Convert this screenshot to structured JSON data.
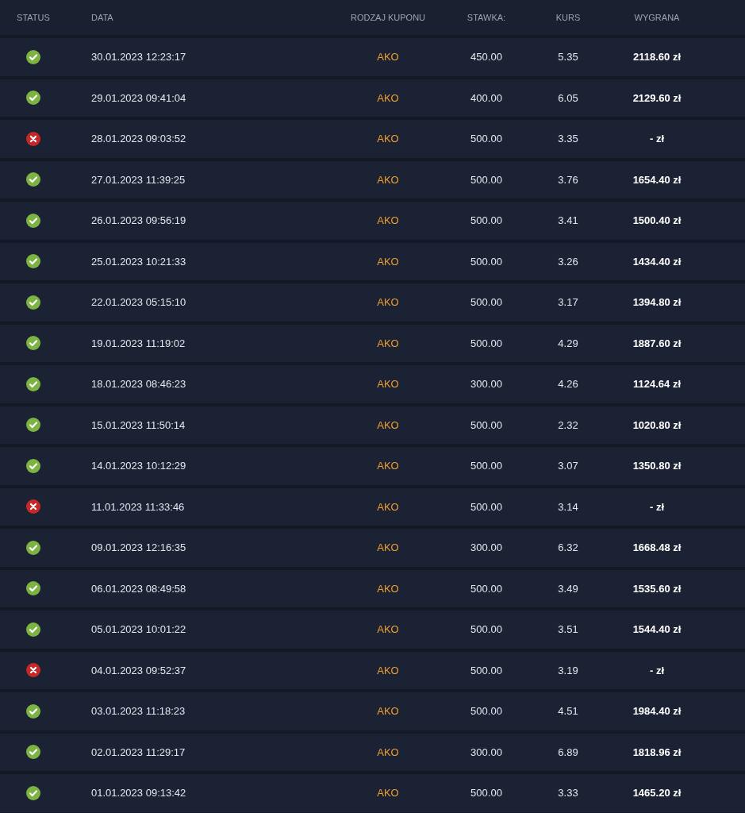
{
  "columns": [
    "STATUS",
    "DATA",
    "RODZAJ KUPONU",
    "STAWKA:",
    "KURS",
    "WYGRANA"
  ],
  "rows": [
    {
      "kind": "won",
      "date": "30.01.2023 12:23:17",
      "type": "AKO",
      "stake": "450.00",
      "odds": "5.35",
      "payout": "2118.60 zł"
    },
    {
      "kind": "won",
      "date": "29.01.2023 09:41:04",
      "type": "AKO",
      "stake": "400.00",
      "odds": "6.05",
      "payout": "2129.60 zł"
    },
    {
      "kind": "lost",
      "date": "28.01.2023 09:03:52",
      "type": "AKO",
      "stake": "500.00",
      "odds": "3.35",
      "payout": "- zł"
    },
    {
      "kind": "won",
      "date": "27.01.2023 11:39:25",
      "type": "AKO",
      "stake": "500.00",
      "odds": "3.76",
      "payout": "1654.40 zł"
    },
    {
      "kind": "won",
      "date": "26.01.2023 09:56:19",
      "type": "AKO",
      "stake": "500.00",
      "odds": "3.41",
      "payout": "1500.40 zł"
    },
    {
      "kind": "won",
      "date": "25.01.2023 10:21:33",
      "type": "AKO",
      "stake": "500.00",
      "odds": "3.26",
      "payout": "1434.40 zł"
    },
    {
      "kind": "won",
      "date": "22.01.2023 05:15:10",
      "type": "AKO",
      "stake": "500.00",
      "odds": "3.17",
      "payout": "1394.80 zł"
    },
    {
      "kind": "won",
      "date": "19.01.2023 11:19:02",
      "type": "AKO",
      "stake": "500.00",
      "odds": "4.29",
      "payout": "1887.60 zł"
    },
    {
      "kind": "won",
      "date": "18.01.2023 08:46:23",
      "type": "AKO",
      "stake": "300.00",
      "odds": "4.26",
      "payout": "1124.64 zł"
    },
    {
      "kind": "won",
      "date": "15.01.2023 11:50:14",
      "type": "AKO",
      "stake": "500.00",
      "odds": "2.32",
      "payout": "1020.80 zł"
    },
    {
      "kind": "won",
      "date": "14.01.2023 10:12:29",
      "type": "AKO",
      "stake": "500.00",
      "odds": "3.07",
      "payout": "1350.80 zł"
    },
    {
      "kind": "lost",
      "date": "11.01.2023 11:33:46",
      "type": "AKO",
      "stake": "500.00",
      "odds": "3.14",
      "payout": "- zł"
    },
    {
      "kind": "won",
      "date": "09.01.2023 12:16:35",
      "type": "AKO",
      "stake": "300.00",
      "odds": "6.32",
      "payout": "1668.48 zł"
    },
    {
      "kind": "won",
      "date": "06.01.2023 08:49:58",
      "type": "AKO",
      "stake": "500.00",
      "odds": "3.49",
      "payout": "1535.60 zł"
    },
    {
      "kind": "won",
      "date": "05.01.2023 10:01:22",
      "type": "AKO",
      "stake": "500.00",
      "odds": "3.51",
      "payout": "1544.40 zł"
    },
    {
      "kind": "lost",
      "date": "04.01.2023 09:52:37",
      "type": "AKO",
      "stake": "500.00",
      "odds": "3.19",
      "payout": "- zł"
    },
    {
      "kind": "won",
      "date": "03.01.2023 11:18:23",
      "type": "AKO",
      "stake": "500.00",
      "odds": "4.51",
      "payout": "1984.40 zł"
    },
    {
      "kind": "won",
      "date": "02.01.2023 11:29:17",
      "type": "AKO",
      "stake": "300.00",
      "odds": "6.89",
      "payout": "1818.96 zł"
    },
    {
      "kind": "won",
      "date": "01.01.2023 09:13:42",
      "type": "AKO",
      "stake": "500.00",
      "odds": "3.33",
      "payout": "1465.20 zł"
    }
  ]
}
